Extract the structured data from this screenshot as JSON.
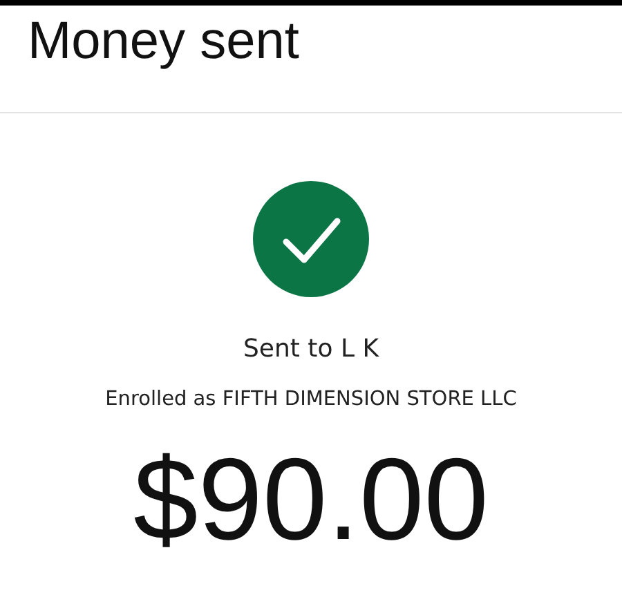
{
  "header": {
    "title": "Money sent"
  },
  "confirmation": {
    "recipient": "Sent to L K",
    "enrolled_as": "Enrolled as FIFTH DIMENSION STORE LLC",
    "amount": "$90.00"
  }
}
